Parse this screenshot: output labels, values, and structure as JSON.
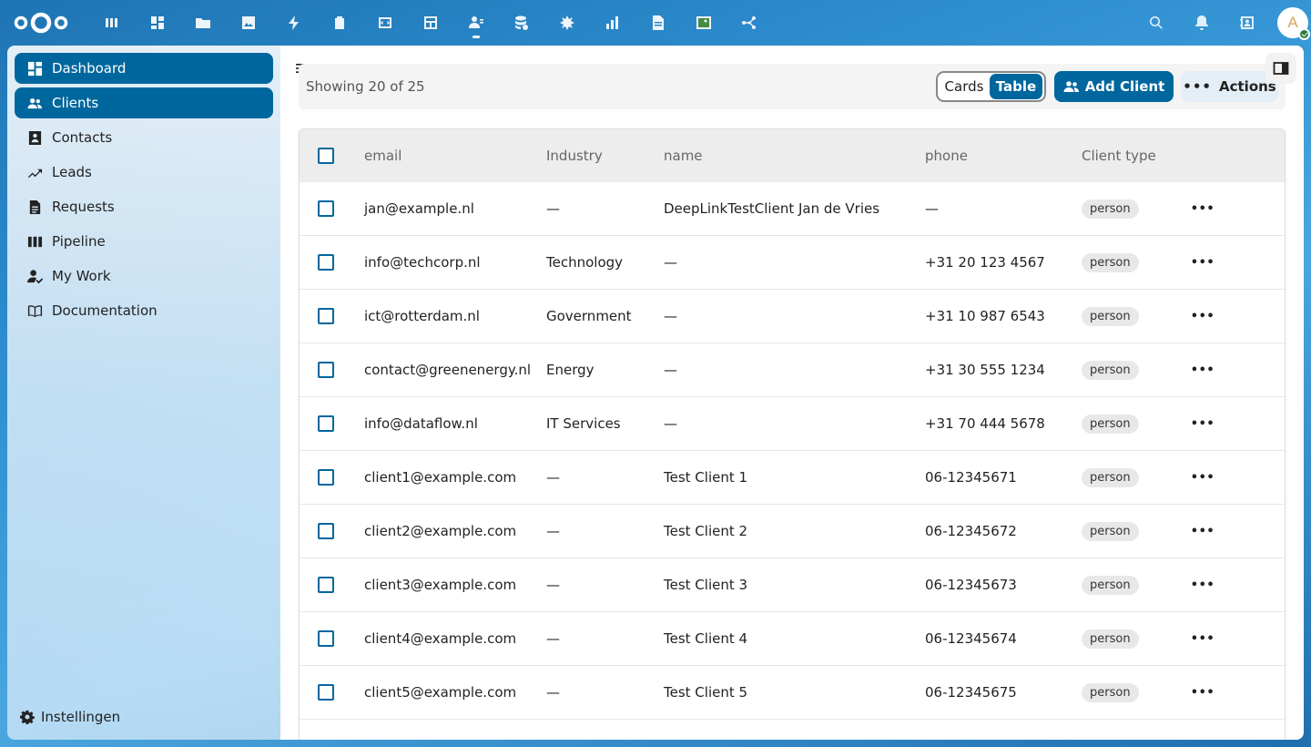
{
  "topbar": {
    "apps": [
      {
        "name": "tables-app-icon"
      },
      {
        "name": "dashboard-app-icon"
      },
      {
        "name": "files-app-icon"
      },
      {
        "name": "photos-app-icon"
      },
      {
        "name": "activity-app-icon"
      },
      {
        "name": "deck-app-icon"
      },
      {
        "name": "code-app-icon"
      },
      {
        "name": "table-app-icon"
      },
      {
        "name": "clients-app-icon"
      },
      {
        "name": "database-app-icon"
      },
      {
        "name": "openregister-app-icon"
      },
      {
        "name": "analytics-app-icon"
      },
      {
        "name": "document-app-icon"
      },
      {
        "name": "image-app-icon"
      },
      {
        "name": "flow-app-icon"
      }
    ],
    "active_app_index": 8,
    "avatar_initial": "A"
  },
  "sidebar": {
    "items": [
      {
        "label": "Dashboard",
        "icon": "dashboard-icon"
      },
      {
        "label": "Clients",
        "icon": "users-icon"
      },
      {
        "label": "Contacts",
        "icon": "contact-card-icon"
      },
      {
        "label": "Leads",
        "icon": "trend-icon"
      },
      {
        "label": "Requests",
        "icon": "document-icon"
      },
      {
        "label": "Pipeline",
        "icon": "columns-icon"
      },
      {
        "label": "My Work",
        "icon": "person-check-icon"
      },
      {
        "label": "Documentation",
        "icon": "book-icon"
      }
    ],
    "settings_label": "Instellingen"
  },
  "toolbar": {
    "showing_text": "Showing 20 of 25",
    "view_cards": "Cards",
    "view_table": "Table",
    "add_label": "Add Client",
    "actions_label": "Actions"
  },
  "table": {
    "headers": {
      "email": "email",
      "industry": "Industry",
      "name": "name",
      "phone": "phone",
      "type": "Client type"
    },
    "rows": [
      {
        "email": "jan@example.nl",
        "industry": "—",
        "name": "DeepLinkTestClient Jan de Vries",
        "phone": "—",
        "type": "person"
      },
      {
        "email": "info@techcorp.nl",
        "industry": "Technology",
        "name": "—",
        "phone": "+31 20 123 4567",
        "type": "person"
      },
      {
        "email": "ict@rotterdam.nl",
        "industry": "Government",
        "name": "—",
        "phone": "+31 10 987 6543",
        "type": "person"
      },
      {
        "email": "contact@greenenergy.nl",
        "industry": "Energy",
        "name": "—",
        "phone": "+31 30 555 1234",
        "type": "person"
      },
      {
        "email": "info@dataflow.nl",
        "industry": "IT Services",
        "name": "—",
        "phone": "+31 70 444 5678",
        "type": "person"
      },
      {
        "email": "client1@example.com",
        "industry": "—",
        "name": "Test Client 1",
        "phone": "06-12345671",
        "type": "person"
      },
      {
        "email": "client2@example.com",
        "industry": "—",
        "name": "Test Client 2",
        "phone": "06-12345672",
        "type": "person"
      },
      {
        "email": "client3@example.com",
        "industry": "—",
        "name": "Test Client 3",
        "phone": "06-12345673",
        "type": "person"
      },
      {
        "email": "client4@example.com",
        "industry": "—",
        "name": "Test Client 4",
        "phone": "06-12345674",
        "type": "person"
      },
      {
        "email": "client5@example.com",
        "industry": "—",
        "name": "Test Client 5",
        "phone": "06-12345675",
        "type": "person"
      }
    ],
    "more_symbol": "•••"
  },
  "colors": {
    "primary": "#00679e",
    "header_bg": "#1f74b3"
  }
}
